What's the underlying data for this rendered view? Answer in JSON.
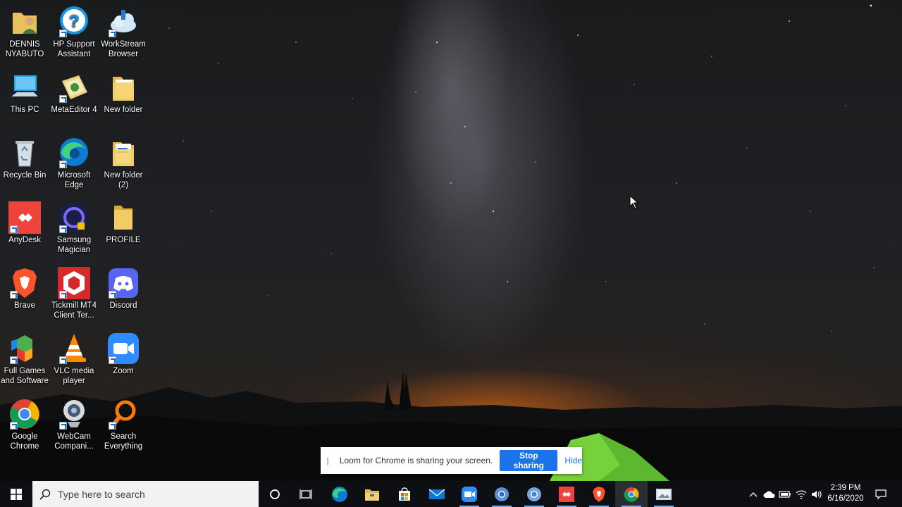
{
  "desktop_icons": [
    {
      "label_line1": "DENNIS",
      "label_line2": "NYABUTO",
      "icon": "user-folder-icon"
    },
    {
      "label_line1": "HP Support",
      "label_line2": "Assistant",
      "icon": "hp-support-icon"
    },
    {
      "label_line1": "WorkStream",
      "label_line2": "Browser",
      "icon": "workstream-icon"
    },
    {
      "label_line1": "This PC",
      "label_line2": "",
      "icon": "computer-icon"
    },
    {
      "label_line1": "MetaEditor 4",
      "label_line2": "",
      "icon": "metaeditor-icon"
    },
    {
      "label_line1": "New folder",
      "label_line2": "",
      "icon": "folder-icon"
    },
    {
      "label_line1": "Recycle Bin",
      "label_line2": "",
      "icon": "recycle-bin-icon"
    },
    {
      "label_line1": "Microsoft",
      "label_line2": "Edge",
      "icon": "edge-icon"
    },
    {
      "label_line1": "New folder",
      "label_line2": "(2)",
      "icon": "folder-icon"
    },
    {
      "label_line1": "AnyDesk",
      "label_line2": "",
      "icon": "anydesk-icon"
    },
    {
      "label_line1": "Samsung",
      "label_line2": "Magician",
      "icon": "samsung-magician-icon"
    },
    {
      "label_line1": "PROFILE",
      "label_line2": "",
      "icon": "folder-icon"
    },
    {
      "label_line1": "Brave",
      "label_line2": "",
      "icon": "brave-icon"
    },
    {
      "label_line1": "Tickmill MT4",
      "label_line2": "Client Ter...",
      "icon": "tickmill-icon"
    },
    {
      "label_line1": "Discord",
      "label_line2": "",
      "icon": "discord-icon"
    },
    {
      "label_line1": "Full Games",
      "label_line2": "and Software",
      "icon": "games-icon"
    },
    {
      "label_line1": "VLC media",
      "label_line2": "player",
      "icon": "vlc-icon"
    },
    {
      "label_line1": "Zoom",
      "label_line2": "",
      "icon": "zoom-icon"
    },
    {
      "label_line1": "Google",
      "label_line2": "Chrome",
      "icon": "chrome-icon"
    },
    {
      "label_line1": "WebCam",
      "label_line2": "Compani...",
      "icon": "webcam-icon"
    },
    {
      "label_line1": "Search",
      "label_line2": "Everything",
      "icon": "search-everything-icon"
    }
  ],
  "loom_bar": {
    "message": "Loom for Chrome is sharing your screen.",
    "stop_label": "Stop sharing",
    "hide_label": "Hide"
  },
  "taskbar": {
    "search_placeholder": "Type here to search",
    "apps": [
      "cortana-icon",
      "task-view-icon",
      "edge-icon",
      "file-explorer-icon",
      "store-icon",
      "mail-icon",
      "zoom-icon",
      "chromium-icon",
      "chromium-icon",
      "anydesk-icon",
      "brave-icon",
      "chrome-icon",
      "photos-icon"
    ],
    "clock_time": "2:39 PM",
    "clock_date": "6/16/2020"
  },
  "colors": {
    "accent": "#1a73e8",
    "taskbar": "#0d0f12",
    "anydesk": "#ef443b",
    "zoom": "#2d8cff",
    "discord": "#5865f2"
  }
}
